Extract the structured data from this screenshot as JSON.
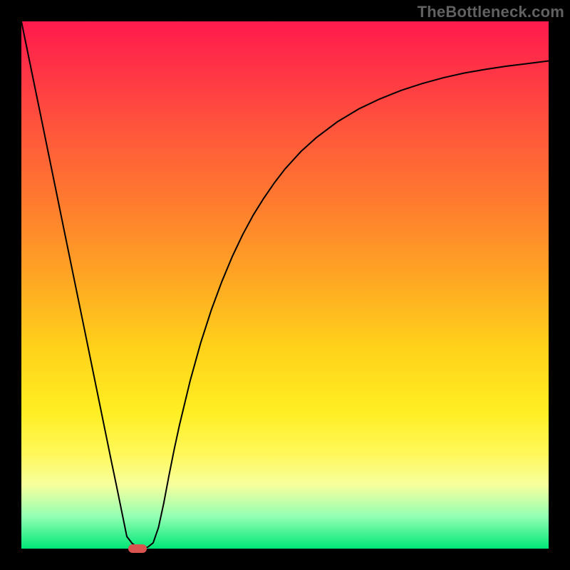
{
  "watermark": "TheBottleneck.com",
  "chart_data": {
    "type": "line",
    "title": "",
    "xlabel": "",
    "ylabel": "",
    "xlim": [
      0,
      100
    ],
    "ylim": [
      0,
      100
    ],
    "grid": false,
    "series": [
      {
        "name": "curve",
        "x": [
          0,
          4,
          8,
          12,
          14,
          16,
          17,
          18,
          19,
          20,
          21,
          22,
          23,
          24,
          25,
          26,
          27,
          28,
          29,
          30,
          32,
          34,
          36,
          38,
          40,
          42,
          44,
          46,
          48,
          50,
          53,
          56,
          60,
          64,
          68,
          72,
          76,
          80,
          84,
          88,
          92,
          96,
          100
        ],
        "y": [
          100,
          80.5,
          60.9,
          41.4,
          31.6,
          21.8,
          16.9,
          12.1,
          7.2,
          2.3,
          1.0,
          0.3,
          0.0,
          0.3,
          1.1,
          4.0,
          8.6,
          13.9,
          18.9,
          23.5,
          31.8,
          39.0,
          45.2,
          50.6,
          55.4,
          59.6,
          63.3,
          66.5,
          69.4,
          72.0,
          75.3,
          78.0,
          81.0,
          83.4,
          85.3,
          86.9,
          88.2,
          89.3,
          90.2,
          90.9,
          91.5,
          92.0,
          92.5
        ]
      }
    ],
    "marker": {
      "x": 22,
      "y": 0,
      "color": "#d9534f"
    },
    "background": "heat-gradient"
  }
}
